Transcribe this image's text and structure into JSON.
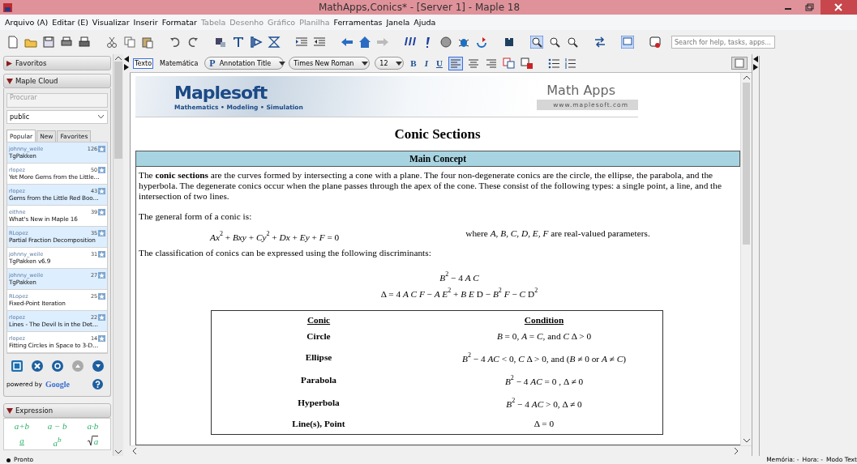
{
  "window": {
    "title": "MathApps,Conics* - [Server 1] - Maple 18"
  },
  "menu": [
    {
      "label": "Arquivo (A)",
      "disabled": false
    },
    {
      "label": "Editar (E)",
      "disabled": false
    },
    {
      "label": "Visualizar",
      "disabled": false
    },
    {
      "label": "Inserir",
      "disabled": false
    },
    {
      "label": "Formatar",
      "disabled": false
    },
    {
      "label": "Tabela",
      "disabled": true
    },
    {
      "label": "Desenho",
      "disabled": true
    },
    {
      "label": "Gráfico",
      "disabled": true
    },
    {
      "label": "Planilha",
      "disabled": true
    },
    {
      "label": "Ferramentas",
      "disabled": false
    },
    {
      "label": "Janela",
      "disabled": false
    },
    {
      "label": "Ajuda",
      "disabled": false
    }
  ],
  "search": {
    "placeholder": "Search for help, tasks, apps..."
  },
  "sidebar": {
    "palettes": [
      {
        "title": "Favoritos",
        "expanded": false
      },
      {
        "title": "Maple Cloud",
        "expanded": true
      }
    ],
    "cloud": {
      "search_placeholder": "Procurar",
      "group": "public",
      "tabs": [
        {
          "label": "Popular",
          "selected": true
        },
        {
          "label": "New",
          "selected": false
        },
        {
          "label": "Favorites",
          "selected": false
        }
      ],
      "items": [
        {
          "user": "johnny_weile",
          "count": "126",
          "title": "TgPakken"
        },
        {
          "user": "rlopez",
          "count": "50",
          "title": "Yet More Gems from the Little…"
        },
        {
          "user": "rlopez",
          "count": "43",
          "title": "Gems from the Little Red Boo…"
        },
        {
          "user": "eithne",
          "count": "39",
          "title": "What's New in Maple 16"
        },
        {
          "user": "RLopez",
          "count": "35",
          "title": "Partial Fraction Decomposition"
        },
        {
          "user": "johnny_weile",
          "count": "31",
          "title": "TgPakken v6.9"
        },
        {
          "user": "johnny_weile",
          "count": "27",
          "title": "TgPakken"
        },
        {
          "user": "RLopez",
          "count": "25",
          "title": "Fixed-Point Iteration"
        },
        {
          "user": "rlopez",
          "count": "22",
          "title": "Lines - The Devil Is in the Det…"
        },
        {
          "user": "rlopez",
          "count": "14",
          "title": "Fitting Circles in Space to 3-D…"
        }
      ],
      "powered_by": "powered by",
      "google": "Google"
    },
    "expression": {
      "title": "Expression",
      "expanded": true,
      "row1": [
        "a+b",
        "a − b",
        "a·b"
      ],
      "fraction": "a",
      "power_base": "a",
      "power_exp": "b",
      "root": "a"
    }
  },
  "format_bar": {
    "modes": [
      {
        "label": "Texto",
        "selected": true
      },
      {
        "label": "Matemática",
        "selected": false
      }
    ],
    "style_marker": "P",
    "style": "Annotation Title",
    "font": "Times New Roman",
    "size": "12",
    "bold": "B",
    "italic": "I",
    "underline": "U",
    "alignments": [
      {
        "selected": true
      },
      {
        "selected": false
      },
      {
        "selected": false
      }
    ]
  },
  "document": {
    "banner": {
      "logo": "Maplesoft",
      "tagline": "Mathematics • Modeling • Simulation",
      "app": "Math Apps",
      "url": "www.maplesoft.com"
    },
    "title": "Conic Sections",
    "section": "Main Concept",
    "paragraph": "The **conic sections** are the curves formed by intersecting a cone with a plane. The four non-degenerate conics are the circle, the ellipse, the parabola, and the hyperbola. The degenerate conics occur when the plane passes through the apex of the cone. These consist of the following types: a single point, a line, and the intersection of two lines.",
    "general_intro": "The general form of a conic is:",
    "general_equation": "*Ax*$^{2}$ + *Bxy* + *Cy*$^{2}$ + *Dx* + *Ey* + *F* = 0",
    "general_note": "where *A*, *B*, *C*, *D*, *E*, *F* are real-valued parameters.",
    "classification_intro": "The classification of conics can be expressed using the following discriminants:",
    "discriminants": [
      "*B*$^{2}$ − 4 *A C*",
      "Δ = 4 *A C F* − *A E*$^{2}$ + *B E* D − *B*$^{2}$ *F* − *C* D$^{2}$"
    ],
    "table": {
      "columns": [
        "Conic",
        "Condition"
      ],
      "rows": [
        [
          "Circle",
          "*B* = 0, *A* = *C*, and *C* Δ > 0"
        ],
        [
          "Ellipse",
          "*B*$^{2}$ − 4 *AC*  < 0, *C* Δ > 0, and (*B* ≠ 0 or *A* ≠ *C*)"
        ],
        [
          "Parabola",
          "*B*$^{2}$ − 4 *AC* = 0 , Δ ≠ 0"
        ],
        [
          "Hyperbola",
          "*B*$^{2}$  − 4 *AC* > 0, Δ ≠ 0"
        ],
        [
          "Line(s), Point",
          "Δ = 0"
        ]
      ]
    }
  },
  "status_bar": {
    "state": "Pronto",
    "memory": "Memória: -",
    "time": "Hora: -",
    "mode": "Modo Text"
  }
}
